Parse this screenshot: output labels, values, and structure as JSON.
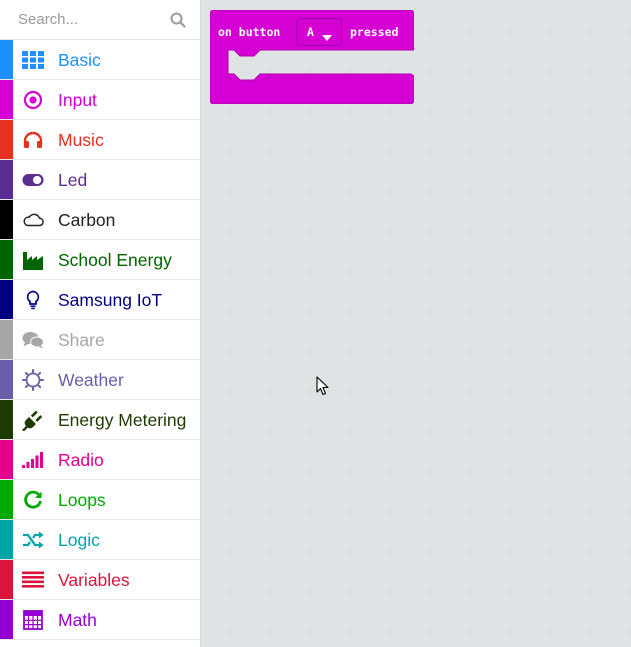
{
  "search": {
    "placeholder": "Search..."
  },
  "categories": [
    {
      "label": "Basic",
      "color": "#1e90ff",
      "icon": "grid-icon"
    },
    {
      "label": "Input",
      "color": "#d400d4",
      "icon": "target-icon"
    },
    {
      "label": "Music",
      "color": "#e63022",
      "icon": "headphones-icon"
    },
    {
      "label": "Led",
      "color": "#5c2d91",
      "icon": "toggle-icon"
    },
    {
      "label": "Carbon",
      "color": "#000000",
      "icon": "cloud-icon"
    },
    {
      "label": "School Energy",
      "color": "#006400",
      "icon": "factory-icon"
    },
    {
      "label": "Samsung IoT",
      "color": "#000080",
      "icon": "lightbulb-icon"
    },
    {
      "label": "Share",
      "color": "#a6a6a6",
      "icon": "chat-icon"
    },
    {
      "label": "Weather",
      "color": "#6b5ea8",
      "icon": "sun-icon"
    },
    {
      "label": "Energy Metering",
      "color": "#1e3a00",
      "icon": "plug-icon"
    },
    {
      "label": "Radio",
      "color": "#e3008c",
      "icon": "signal-icon"
    },
    {
      "label": "Loops",
      "color": "#00aa00",
      "icon": "refresh-icon"
    },
    {
      "label": "Logic",
      "color": "#00a4a6",
      "icon": "shuffle-icon"
    },
    {
      "label": "Variables",
      "color": "#dc143c",
      "icon": "list-icon"
    },
    {
      "label": "Math",
      "color": "#9400d3",
      "icon": "calculator-icon"
    }
  ],
  "workspace": {
    "block": {
      "color": "#d400d4",
      "text_prefix": "on button",
      "dropdown_value": "A",
      "text_suffix": "pressed"
    }
  }
}
